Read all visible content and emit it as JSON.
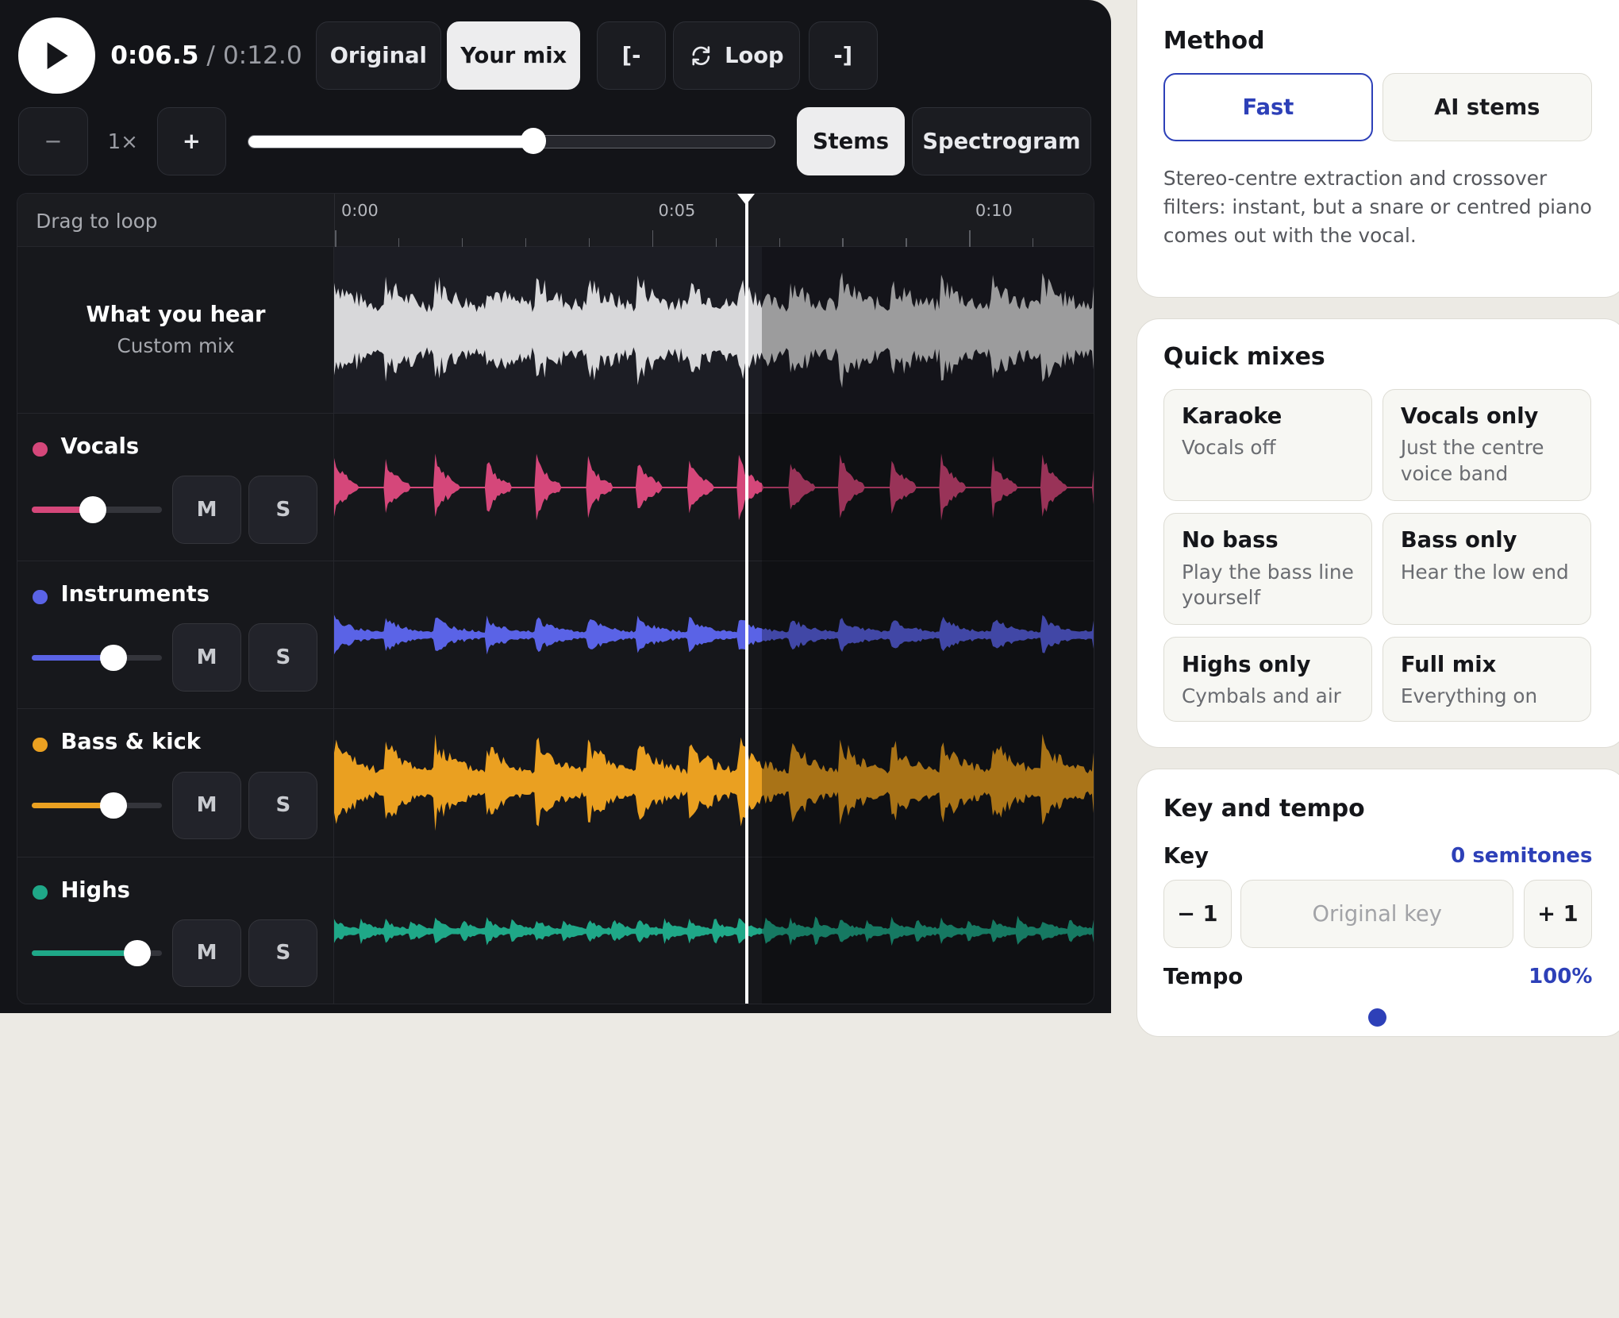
{
  "transport": {
    "play_icon": "play-icon",
    "current": "0:06.5",
    "separator": " / ",
    "duration": "0:12.0",
    "progress_fraction": 0.54
  },
  "view_toggle": {
    "original": "Original",
    "your_mix": "Your mix",
    "active": "your_mix"
  },
  "loop": {
    "start": "[-",
    "label": "Loop",
    "end": "-]",
    "loop_icon": "loop-icon"
  },
  "speed": {
    "minus": "−",
    "value": "1×",
    "plus": "+"
  },
  "display_toggle": {
    "stems": "Stems",
    "spectrogram": "Spectrogram",
    "active": "stems"
  },
  "timeline": {
    "hint": "Drag to loop",
    "ticks": [
      "0:00",
      "0:05",
      "0:10"
    ],
    "playhead_seconds": 6.5,
    "duration_seconds": 12
  },
  "master": {
    "title": "What you hear",
    "subtitle": "Custom mix",
    "color": "#d8d8da"
  },
  "tracks": [
    {
      "name": "Vocals",
      "color": "#d5477a",
      "volume": 0.47,
      "mute": "M",
      "solo": "S"
    },
    {
      "name": "Instruments",
      "color": "#5a63e6",
      "volume": 0.63,
      "mute": "M",
      "solo": "S"
    },
    {
      "name": "Bass & kick",
      "color": "#eaa021",
      "volume": 0.63,
      "mute": "M",
      "solo": "S"
    },
    {
      "name": "Highs",
      "color": "#1fa888",
      "volume": 0.81,
      "mute": "M",
      "solo": "S"
    }
  ],
  "method": {
    "title": "Method",
    "options": [
      "Fast",
      "AI stems"
    ],
    "selected": "Fast",
    "description": "Stereo-centre extraction and crossover filters: instant, but a snare or centred piano comes out with the vocal."
  },
  "quick_mixes": {
    "title": "Quick mixes",
    "items": [
      {
        "title": "Karaoke",
        "subtitle": "Vocals off"
      },
      {
        "title": "Vocals only",
        "subtitle": "Just the centre voice band"
      },
      {
        "title": "No bass",
        "subtitle": "Play the bass line yourself"
      },
      {
        "title": "Bass only",
        "subtitle": "Hear the low end"
      },
      {
        "title": "Highs only",
        "subtitle": "Cymbals and air"
      },
      {
        "title": "Full mix",
        "subtitle": "Everything on"
      }
    ]
  },
  "key_tempo": {
    "title": "Key and tempo",
    "key_label": "Key",
    "key_value": "0 semitones",
    "down": "− 1",
    "reset": "Original key",
    "up": "+ 1",
    "tempo_label": "Tempo",
    "tempo_value": "100%"
  },
  "colors": {
    "accent": "#2d40b8",
    "dark_bg": "#131418"
  }
}
